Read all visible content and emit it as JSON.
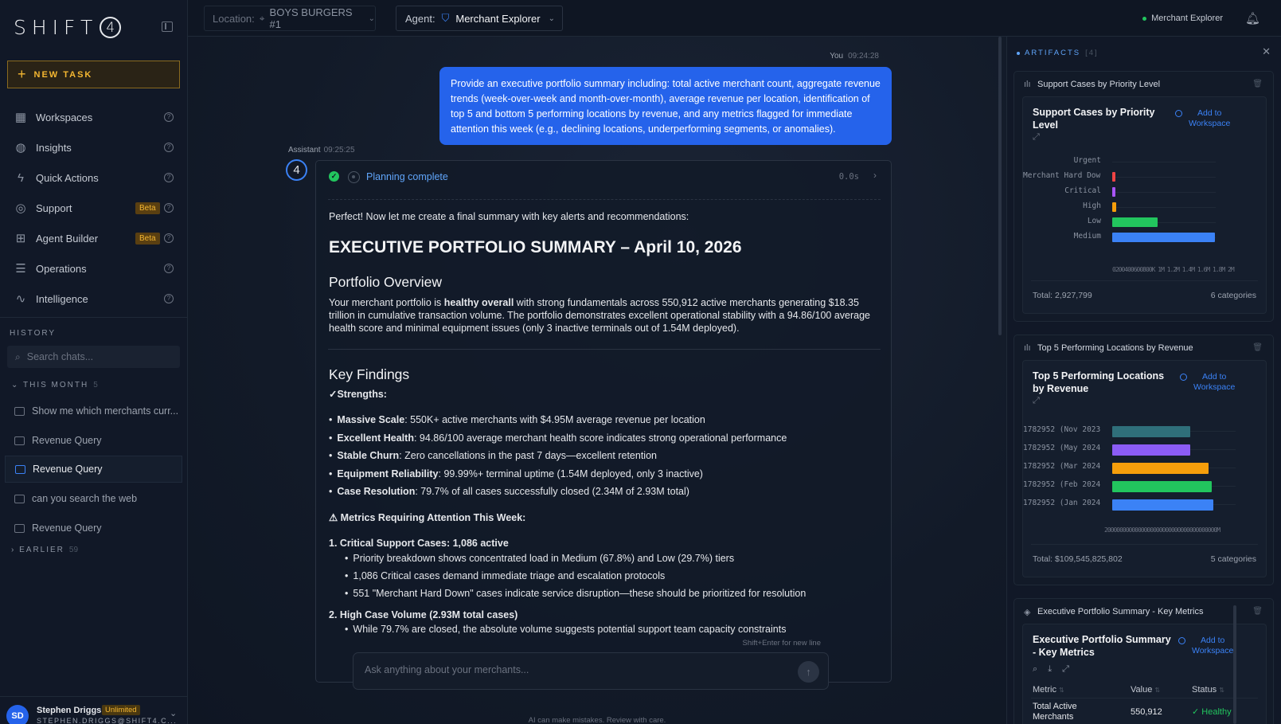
{
  "app": {
    "logo_text": "SHIFT",
    "logo_mark": "4"
  },
  "sidebar": {
    "new_task_label": "NEW TASK",
    "nav": [
      {
        "label": "Workspaces",
        "icon": "grid-icon"
      },
      {
        "label": "Insights",
        "icon": "globe-icon"
      },
      {
        "label": "Quick Actions",
        "icon": "bolt-icon"
      },
      {
        "label": "Support",
        "icon": "lifebuoy-icon",
        "badge": "Beta"
      },
      {
        "label": "Agent Builder",
        "icon": "blocks-icon",
        "badge": "Beta"
      },
      {
        "label": "Operations",
        "icon": "sliders-icon"
      },
      {
        "label": "Intelligence",
        "icon": "pulse-icon"
      }
    ],
    "history_label": "HISTORY",
    "search_placeholder": "Search chats...",
    "group_this_month": {
      "label": "THIS MONTH",
      "count": "5"
    },
    "chats": [
      {
        "title": "Show me which merchants curr...",
        "active": false
      },
      {
        "title": "Revenue Query",
        "active": false
      },
      {
        "title": "Revenue Query",
        "active": true
      },
      {
        "title": "can you search the web",
        "active": false
      },
      {
        "title": "Revenue Query",
        "active": false
      }
    ],
    "group_earlier": {
      "label": "EARLIER",
      "count": "59"
    },
    "user": {
      "initials": "SD",
      "name": "Stephen Driggs",
      "plan": "Unlimited",
      "email": "STEPHEN.DRIGGS@SHIFT4.C..."
    }
  },
  "topbar": {
    "location_label": "Location:",
    "location_value": "BOYS BURGERS #1",
    "agent_label": "Agent:",
    "agent_value": "Merchant Explorer",
    "status_text": "Merchant Explorer"
  },
  "chat": {
    "user_message": {
      "author": "You",
      "time": "09:24:28",
      "text": "Provide an executive portfolio summary including: total active merchant count, aggregate revenue trends (week-over-week and month-over-month), average revenue per location, identification of top 5 and bottom 5 performing locations by revenue, and any metrics flagged for immediate attention this week (e.g., declining locations, underperforming segments, or anomalies)."
    },
    "assistant": {
      "author": "Assistant",
      "time": "09:25:25",
      "avatar": "4",
      "plan_status": "Planning complete",
      "plan_time": "0.0s",
      "intro": "Perfect! Now let me create a final summary with key alerts and recommendations:",
      "title": "EXECUTIVE PORTFOLIO SUMMARY – April 10, 2026",
      "overview_heading": "Portfolio Overview",
      "overview_pre": "Your merchant portfolio is ",
      "overview_strong": "healthy overall",
      "overview_post": " with strong fundamentals across 550,912 active merchants generating $18.35 trillion in cumulative transaction volume. The portfolio demonstrates excellent operational stability with a 94.86/100 average health score and minimal equipment issues (only 3 inactive terminals out of 1.54M deployed).",
      "findings_heading": "Key Findings",
      "strengths_label": "✓Strengths:",
      "strengths": [
        {
          "k": "Massive Scale",
          "v": ": 550K+ active merchants with $4.95M average revenue per location"
        },
        {
          "k": "Excellent Health",
          "v": ": 94.86/100 average merchant health score indicates strong operational performance"
        },
        {
          "k": "Stable Churn",
          "v": ": Zero cancellations in the past 7 days—excellent retention"
        },
        {
          "k": "Equipment Reliability",
          "v": ": 99.99%+ terminal uptime (1.54M deployed, only 3 inactive)"
        },
        {
          "k": "Case Resolution",
          "v": ": 79.7% of all cases successfully closed (2.34M of 2.93M total)"
        }
      ],
      "attention_label": "⚠ Metrics Requiring Attention This Week:",
      "item1_title": "1. Critical Support Cases: 1,086 active",
      "item1_subs": [
        "Priority breakdown shows concentrated load in Medium (67.8%) and Low (29.7%) tiers",
        "1,086 Critical cases demand immediate triage and escalation protocols",
        "551 \"Merchant Hard Down\" cases indicate service disruption—these should be prioritized for resolution"
      ],
      "item2_title": "2. High Case Volume (2.93M total cases)",
      "item2_subs": [
        "While 79.7% are closed, the absolute volume suggests potential support team capacity constraints"
      ]
    },
    "input_hint": "Shift+Enter for new line",
    "input_placeholder": "Ask anything about your merchants...",
    "disclaimer": "AI can make mistakes. Review with care."
  },
  "artifacts": {
    "header": "ARTIFACTS",
    "count": "[4]",
    "add_label_1": "Add to",
    "add_label_2": "Workspace",
    "items": [
      {
        "header": "Support Cases by Priority Level",
        "title": "Support Cases by Priority Level",
        "total": "Total: 2,927,799",
        "categories_count": "6 categories",
        "ticks": "0200400600800K 1M 1.2M 1.4M 1.6M 1.8M 2M"
      },
      {
        "header": "Top 5 Performing Locations by Revenue",
        "title": "Top 5 Performing Locations by Revenue",
        "total": "Total: $109,545,825,802",
        "categories_count": "5 categories",
        "ticks": "2000000000000000000000000000000000000M"
      },
      {
        "header": "Executive Portfolio Summary - Key Metrics",
        "title": "Executive Portfolio Summary - Key Metrics",
        "columns": [
          "Metric",
          "Value",
          "Status"
        ],
        "rows": [
          {
            "metric": "Total Active Merchants",
            "value": "550,912",
            "status": "✓ Healthy"
          }
        ]
      }
    ]
  },
  "chart_data": [
    {
      "type": "bar",
      "orientation": "horizontal",
      "title": "Support Cases by Priority Level",
      "categories": [
        "Urgent",
        "Merchant Hard Down",
        "Critical",
        "High",
        "Low",
        "Medium"
      ],
      "values": [
        0,
        551,
        1086,
        70000,
        870000,
        1985000
      ],
      "colors": [
        "#3b82f6",
        "#ef4444",
        "#a855f7",
        "#f59e0b",
        "#22c55e",
        "#3b82f6"
      ],
      "xlim": [
        0,
        2000000
      ]
    },
    {
      "type": "bar",
      "orientation": "horizontal",
      "title": "Top 5 Performing Locations by Revenue",
      "categories": [
        "1782952 (Nov 2023)",
        "1782952 (May 2024)",
        "1782952 (Mar 2024)",
        "1782952 (Feb 2024)",
        "1782952 (Jan 2024)"
      ],
      "values": [
        19000000000,
        19000000000,
        23500000000,
        24200000000,
        24600000000
      ],
      "colors": [
        "#2f6f7a",
        "#8b5cf6",
        "#f59e0b",
        "#22c55e",
        "#3b82f6"
      ],
      "xlim": [
        0,
        30000000000
      ]
    }
  ]
}
